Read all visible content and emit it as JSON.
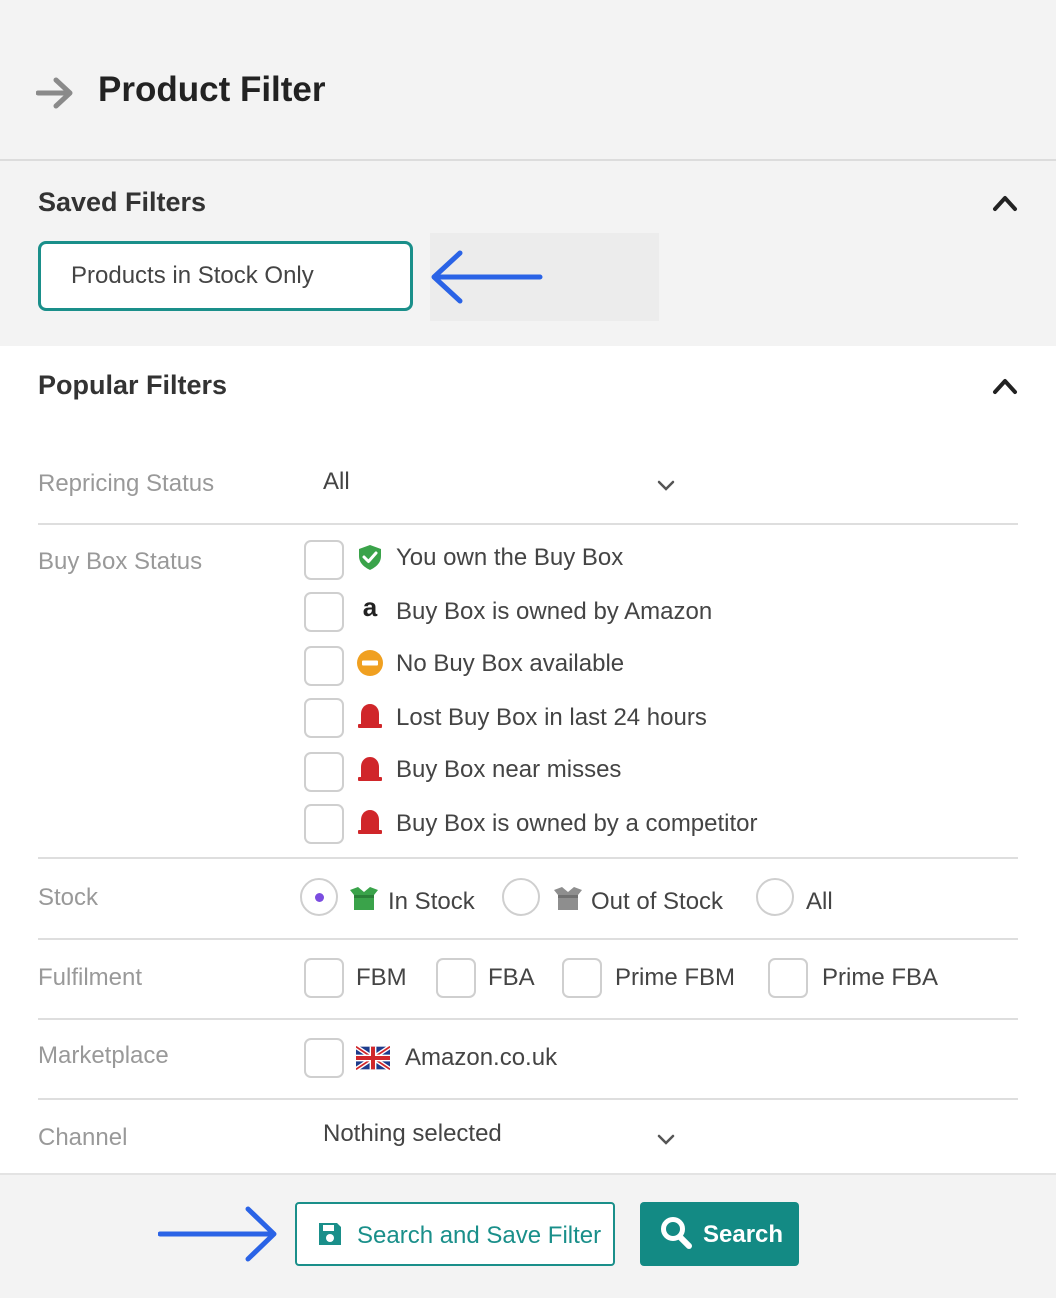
{
  "header": {
    "title": "Product Filter",
    "back_icon": "arrow-right-icon"
  },
  "saved_filters": {
    "title": "Saved Filters",
    "input_value": "Products in Stock Only",
    "collapse_icon": "chevron-up-icon"
  },
  "popular_filters": {
    "title": "Popular Filters",
    "collapse_icon": "chevron-up-icon",
    "repricing_status": {
      "label": "Repricing Status",
      "value": "All"
    },
    "buy_box_status": {
      "label": "Buy Box Status",
      "options": [
        {
          "label": "You own the Buy Box",
          "icon": "shield-check-icon",
          "color": "#3aa34a"
        },
        {
          "label": "Buy Box is owned by Amazon",
          "icon": "amazon-icon",
          "color": "#222222"
        },
        {
          "label": "No Buy Box available",
          "icon": "no-entry-icon",
          "color": "#f0a020"
        },
        {
          "label": "Lost Buy Box in last 24 hours",
          "icon": "alarm-bell-icon",
          "color": "#d0262a"
        },
        {
          "label": "Buy Box near misses",
          "icon": "alarm-bell-icon",
          "color": "#d0262a"
        },
        {
          "label": "Buy Box is owned by a competitor",
          "icon": "alarm-bell-icon",
          "color": "#d0262a"
        }
      ]
    },
    "stock": {
      "label": "Stock",
      "options": [
        {
          "label": "In Stock",
          "icon": "box-open-green-icon",
          "selected": true
        },
        {
          "label": "Out of Stock",
          "icon": "box-open-grey-icon",
          "selected": false
        },
        {
          "label": "All",
          "selected": false
        }
      ]
    },
    "fulfilment": {
      "label": "Fulfilment",
      "options": [
        "FBM",
        "FBA",
        "Prime FBM",
        "Prime FBA"
      ]
    },
    "marketplace": {
      "label": "Marketplace",
      "options": [
        {
          "label": "Amazon.co.uk",
          "icon": "uk-flag-icon"
        }
      ]
    },
    "channel": {
      "label": "Channel",
      "value": "Nothing selected"
    }
  },
  "footer": {
    "save_button": "Search and Save Filter",
    "search_button": "Search"
  },
  "colors": {
    "accent": "#138a84",
    "annotation_arrow": "#2a63e6",
    "radio_selected": "#7b4de0"
  }
}
